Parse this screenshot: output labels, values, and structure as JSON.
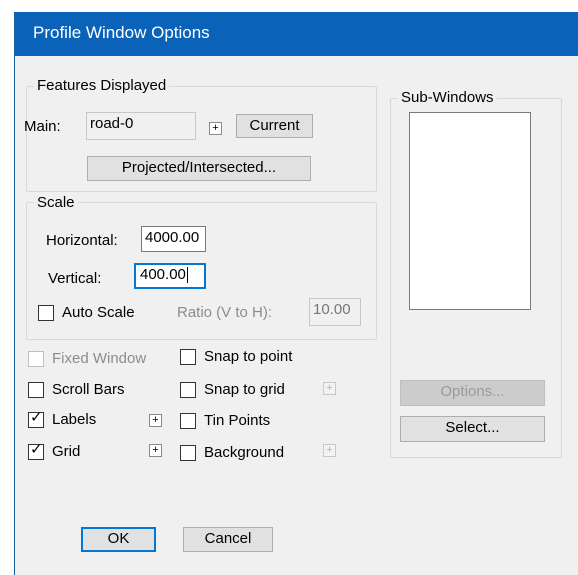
{
  "window": {
    "title": "Profile Window Options"
  },
  "features": {
    "legend": "Features Displayed",
    "main_label": "Main:",
    "main_value": "road-0",
    "plus_symbol": "+",
    "current_button": "Current",
    "projected_button": "Projected/Intersected..."
  },
  "scale": {
    "legend": "Scale",
    "horizontal_label": "Horizontal:",
    "horizontal_value": "4000.00",
    "vertical_label": "Vertical:",
    "vertical_value": "400.00",
    "auto_scale_label": "Auto Scale",
    "auto_scale_checked": false,
    "ratio_label": "Ratio (V to H):",
    "ratio_value": "10.00"
  },
  "options_left": {
    "fixed_window": {
      "label": "Fixed Window",
      "checked": false,
      "disabled": true
    },
    "scroll_bars": {
      "label": "Scroll Bars",
      "checked": false
    },
    "labels": {
      "label": "Labels",
      "checked": true
    },
    "grid": {
      "label": "Grid",
      "checked": true
    }
  },
  "options_right": {
    "snap_to_point": {
      "label": "Snap to point",
      "checked": false
    },
    "snap_to_grid": {
      "label": "Snap to grid",
      "checked": false
    },
    "tin_points": {
      "label": "Tin Points",
      "checked": false
    },
    "background": {
      "label": "Background",
      "checked": false
    }
  },
  "subwindows": {
    "legend": "Sub-Windows",
    "options_button": "Options...",
    "select_button": "Select..."
  },
  "footer": {
    "ok_button": "OK",
    "cancel_button": "Cancel"
  },
  "check_mark": "✓",
  "colors": {
    "titlebar": "#0a63b8",
    "dialog_bg": "#f0f0f0",
    "focus_border": "#0078d7"
  }
}
